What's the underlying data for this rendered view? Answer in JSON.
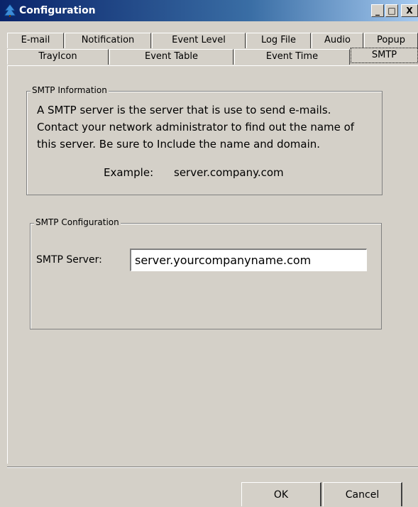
{
  "window": {
    "title": "Configuration",
    "controls": {
      "minimize": "_",
      "maximize": "□",
      "close": "X"
    }
  },
  "tabs_row1": [
    "E-mail",
    "Notification",
    "Event Level",
    "Log File",
    "Audio",
    "Popup"
  ],
  "tabs_row2": [
    "TrayIcon",
    "Event Table",
    "Event Time",
    "SMTP"
  ],
  "active_tab": "SMTP",
  "smtp_info": {
    "legend": "SMTP Information",
    "lines": [
      "A SMTP server is the server that is use to send e-mails.",
      "Contact your network administrator to find out the name of",
      "this server. Be sure to Include the name and domain."
    ],
    "example_label": "Example:",
    "example_value": "server.company.com"
  },
  "smtp_config": {
    "legend": "SMTP Configuration",
    "server_label": "SMTP Server:",
    "server_value": "server.yourcompanyname.com"
  },
  "buttons": {
    "ok": "OK",
    "cancel": "Cancel"
  },
  "colors": {
    "dialog_bg": "#d4d0c8",
    "title_gradient_start": "#0a246a",
    "title_gradient_end": "#a6caf0"
  }
}
